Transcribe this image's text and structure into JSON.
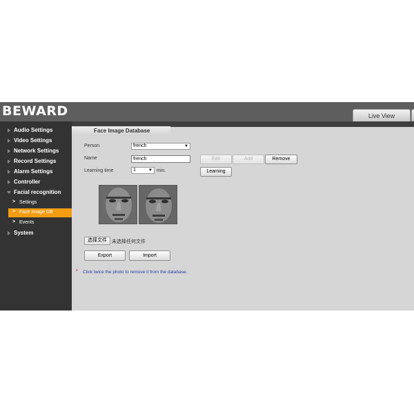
{
  "header": {
    "logo": "BEWARD",
    "tab_live_view": "Live View"
  },
  "sidebar": {
    "items": [
      {
        "label": "Audio Settings",
        "expanded": false
      },
      {
        "label": "Video Settings",
        "expanded": false
      },
      {
        "label": "Network Settings",
        "expanded": false
      },
      {
        "label": "Record Settings",
        "expanded": false
      },
      {
        "label": "Alarm Settings",
        "expanded": false
      },
      {
        "label": "Controller",
        "expanded": false
      },
      {
        "label": "Facial recognition",
        "expanded": true
      },
      {
        "label": "System",
        "expanded": false
      }
    ],
    "subitems": [
      {
        "label": "Settings",
        "active": false
      },
      {
        "label": "Face Image DB",
        "active": true
      },
      {
        "label": "Events",
        "active": false
      }
    ],
    "active_color": "#f39c12"
  },
  "content": {
    "tab_title": "Face Image Database",
    "person_label": "Person",
    "person_value": "french",
    "name_label": "Name",
    "name_value": "french",
    "learning_time_label": "Learning time",
    "learning_time_value": "1",
    "learning_time_unit": "min.",
    "buttons": {
      "edit": "Edit",
      "add": "Add",
      "remove": "Remove",
      "learning": "Learning"
    },
    "file_button": "选择文件",
    "file_status": "未选择任何文件",
    "export_button": "Export",
    "import_button": "Import",
    "note_marker": "*",
    "note_text": "Click twice the photo to remove it from the database."
  },
  "icons": {
    "dropdown": "chevron-down-icon",
    "nav_collapsed": "triangle-right-icon",
    "nav_expanded": "triangle-down-icon",
    "subitem": "chevron-right-icon"
  }
}
